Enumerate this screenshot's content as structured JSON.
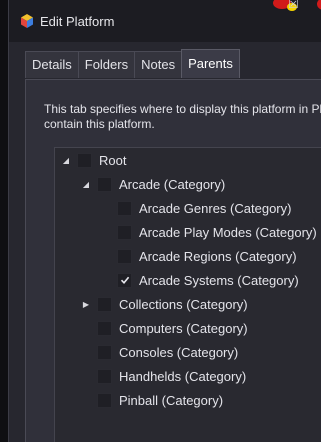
{
  "window": {
    "title": "Edit Platform"
  },
  "tabs": [
    {
      "label": "Details",
      "active": false
    },
    {
      "label": "Folders",
      "active": false
    },
    {
      "label": "Notes",
      "active": false
    },
    {
      "label": "Parents",
      "active": true
    }
  ],
  "parents_tab": {
    "description_line1": "This tab specifies where to display this platform in Pla",
    "description_line2": "contain this platform."
  },
  "tree": [
    {
      "label": "Root",
      "expanded": true,
      "checked": false
    },
    {
      "label": "Arcade (Category)",
      "expanded": true,
      "checked": false
    },
    {
      "label": "Arcade Genres (Category)",
      "checked": false
    },
    {
      "label": "Arcade Play Modes (Category)",
      "checked": false
    },
    {
      "label": "Arcade Regions (Category)",
      "checked": false
    },
    {
      "label": "Arcade Systems (Category)",
      "checked": true
    },
    {
      "label": "Collections (Category)",
      "expanded": false,
      "checked": false
    },
    {
      "label": "Computers (Category)",
      "checked": false
    },
    {
      "label": "Consoles (Category)",
      "checked": false
    },
    {
      "label": "Handhelds (Category)",
      "checked": false
    },
    {
      "label": "Pinball (Category)",
      "checked": false
    }
  ],
  "icons": {
    "app": "launchbox-cube-icon",
    "expanded": "triangle-down-icon",
    "collapsed": "triangle-right-icon",
    "check": "checkmark-icon"
  },
  "colors": {
    "window_bg": "#27272f",
    "titlebar_bg": "#1c1c22",
    "panel_bg": "#30303a",
    "text": "#e4e4ea"
  }
}
